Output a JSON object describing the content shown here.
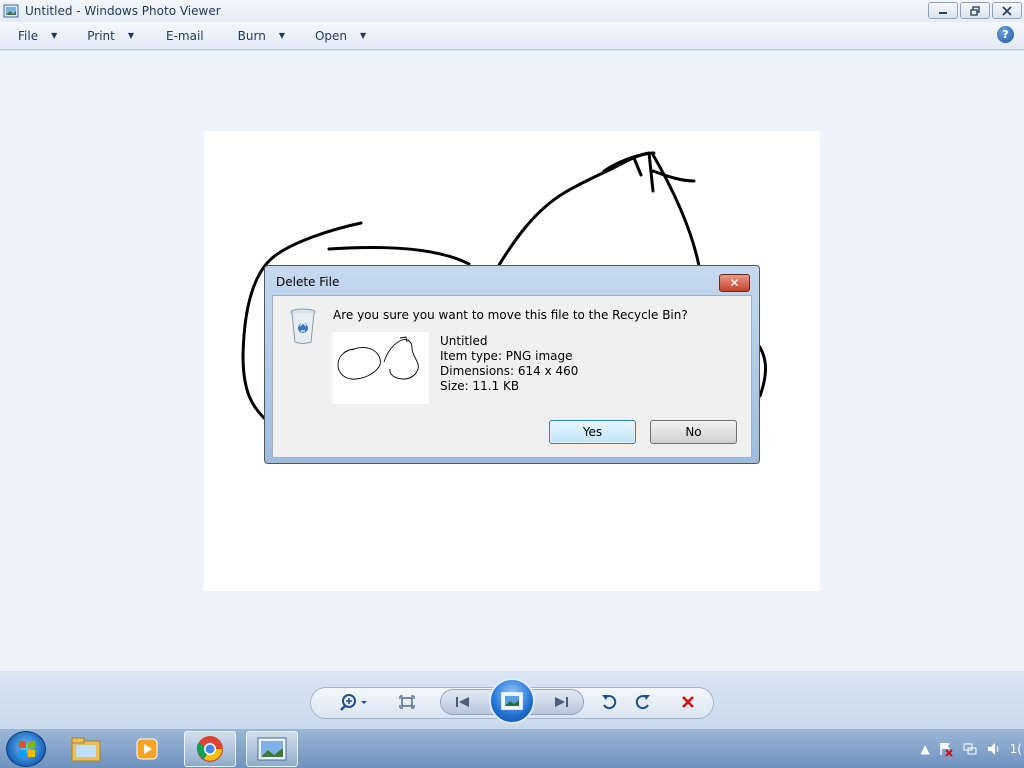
{
  "window": {
    "title": "Untitled - Windows Photo Viewer"
  },
  "menu": {
    "file": "File",
    "print": "Print",
    "email": "E-mail",
    "burn": "Burn",
    "open": "Open",
    "help": "?"
  },
  "dialog": {
    "title": "Delete File",
    "close": "✕",
    "question": "Are you sure you want to move this file to the Recycle Bin?",
    "file_name": "Untitled",
    "item_type": "Item type: PNG image",
    "dimensions": "Dimensions: 614 x 460",
    "size": "Size: 11.1 KB",
    "yes": "Yes",
    "no": "No"
  },
  "tray": {
    "clock_partial": "1("
  },
  "icons": [
    "app-photo-icon",
    "minimize-icon",
    "restore-icon",
    "close-icon",
    "help-icon",
    "recycle-bin-icon",
    "zoom-icon",
    "actual-size-icon",
    "previous-icon",
    "slideshow-icon",
    "next-icon",
    "rotate-counterclockwise-icon",
    "rotate-clockwise-icon",
    "delete-icon",
    "start-orb-icon",
    "explorer-icon",
    "media-player-icon",
    "chrome-icon",
    "photo-viewer-icon"
  ],
  "colors": {
    "accent": "#1c56a8",
    "delete_red": "#d01010",
    "dialog_frame": "#c5d9ef"
  }
}
